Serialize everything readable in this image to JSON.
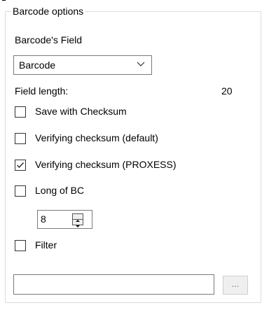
{
  "group": {
    "title": "Barcode options"
  },
  "barcode_field": {
    "label": "Barcode's Field",
    "selected": "Barcode",
    "arrow_icon": "chevron-down-icon"
  },
  "field_length": {
    "label": "Field length:",
    "value": "20"
  },
  "checkboxes": [
    {
      "label": "Save with Checksum",
      "checked": false
    },
    {
      "label": "Verifying checksum (default)",
      "checked": false
    },
    {
      "label": "Verifying checksum (PROXESS)",
      "checked": true
    },
    {
      "label": "Long of BC",
      "checked": false
    }
  ],
  "long_of_bc_spinner": {
    "value": "8"
  },
  "filter": {
    "label": "Filter",
    "checked": false,
    "value": ""
  },
  "browse_button": {
    "label": "..."
  }
}
